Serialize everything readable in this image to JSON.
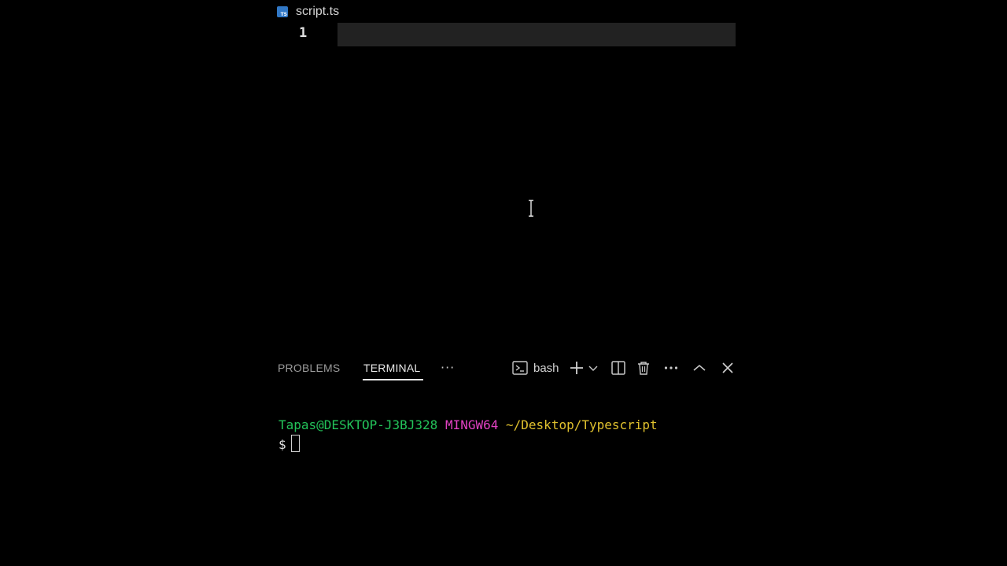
{
  "editor": {
    "file_name": "script.ts",
    "file_icon": "typescript-file-icon",
    "file_icon_text": "TS",
    "line_numbers": [
      "1"
    ],
    "accent_color": "#3178c6"
  },
  "panel": {
    "tabs": [
      {
        "label": "PROBLEMS",
        "active": false
      },
      {
        "label": "TERMINAL",
        "active": true
      }
    ],
    "more_label": "···",
    "terminal_name": "bash",
    "toolbar_icons": [
      "terminal-icon",
      "plus-icon",
      "chevron-down-icon",
      "split-icon",
      "trash-icon",
      "more-icon",
      "chevron-up-icon",
      "close-icon"
    ]
  },
  "terminal": {
    "user_host": "Tapas@DESKTOP-J3BJ328",
    "system": "MINGW64",
    "path": "~/Desktop/Typescript",
    "prompt": "$",
    "colors": {
      "user": "#23c35a",
      "system": "#e242c3",
      "path": "#e0c12e"
    }
  }
}
